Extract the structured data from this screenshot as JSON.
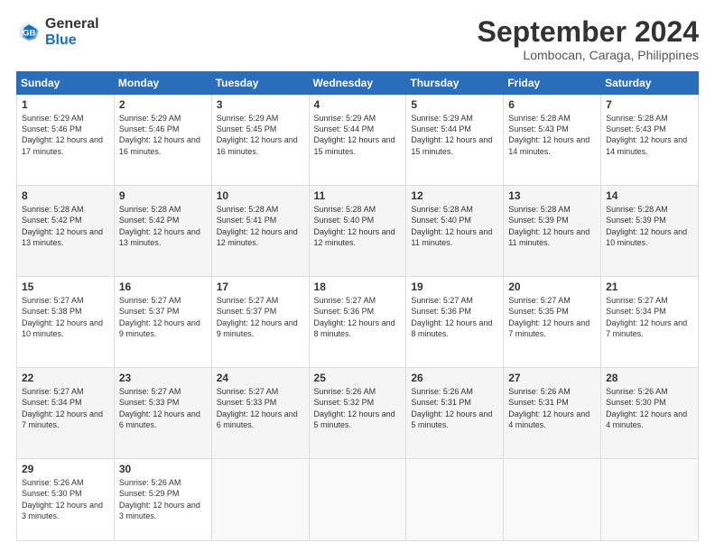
{
  "header": {
    "logo_line1": "General",
    "logo_line2": "Blue",
    "month": "September 2024",
    "location": "Lombocan, Caraga, Philippines"
  },
  "days_of_week": [
    "Sunday",
    "Monday",
    "Tuesday",
    "Wednesday",
    "Thursday",
    "Friday",
    "Saturday"
  ],
  "weeks": [
    [
      {
        "day": "1",
        "sunrise": "5:29 AM",
        "sunset": "5:46 PM",
        "daylight": "12 hours and 17 minutes."
      },
      {
        "day": "2",
        "sunrise": "5:29 AM",
        "sunset": "5:46 PM",
        "daylight": "12 hours and 16 minutes."
      },
      {
        "day": "3",
        "sunrise": "5:29 AM",
        "sunset": "5:45 PM",
        "daylight": "12 hours and 16 minutes."
      },
      {
        "day": "4",
        "sunrise": "5:29 AM",
        "sunset": "5:44 PM",
        "daylight": "12 hours and 15 minutes."
      },
      {
        "day": "5",
        "sunrise": "5:29 AM",
        "sunset": "5:44 PM",
        "daylight": "12 hours and 15 minutes."
      },
      {
        "day": "6",
        "sunrise": "5:28 AM",
        "sunset": "5:43 PM",
        "daylight": "12 hours and 14 minutes."
      },
      {
        "day": "7",
        "sunrise": "5:28 AM",
        "sunset": "5:43 PM",
        "daylight": "12 hours and 14 minutes."
      }
    ],
    [
      {
        "day": "8",
        "sunrise": "5:28 AM",
        "sunset": "5:42 PM",
        "daylight": "12 hours and 13 minutes."
      },
      {
        "day": "9",
        "sunrise": "5:28 AM",
        "sunset": "5:42 PM",
        "daylight": "12 hours and 13 minutes."
      },
      {
        "day": "10",
        "sunrise": "5:28 AM",
        "sunset": "5:41 PM",
        "daylight": "12 hours and 12 minutes."
      },
      {
        "day": "11",
        "sunrise": "5:28 AM",
        "sunset": "5:40 PM",
        "daylight": "12 hours and 12 minutes."
      },
      {
        "day": "12",
        "sunrise": "5:28 AM",
        "sunset": "5:40 PM",
        "daylight": "12 hours and 11 minutes."
      },
      {
        "day": "13",
        "sunrise": "5:28 AM",
        "sunset": "5:39 PM",
        "daylight": "12 hours and 11 minutes."
      },
      {
        "day": "14",
        "sunrise": "5:28 AM",
        "sunset": "5:39 PM",
        "daylight": "12 hours and 10 minutes."
      }
    ],
    [
      {
        "day": "15",
        "sunrise": "5:27 AM",
        "sunset": "5:38 PM",
        "daylight": "12 hours and 10 minutes."
      },
      {
        "day": "16",
        "sunrise": "5:27 AM",
        "sunset": "5:37 PM",
        "daylight": "12 hours and 9 minutes."
      },
      {
        "day": "17",
        "sunrise": "5:27 AM",
        "sunset": "5:37 PM",
        "daylight": "12 hours and 9 minutes."
      },
      {
        "day": "18",
        "sunrise": "5:27 AM",
        "sunset": "5:36 PM",
        "daylight": "12 hours and 8 minutes."
      },
      {
        "day": "19",
        "sunrise": "5:27 AM",
        "sunset": "5:36 PM",
        "daylight": "12 hours and 8 minutes."
      },
      {
        "day": "20",
        "sunrise": "5:27 AM",
        "sunset": "5:35 PM",
        "daylight": "12 hours and 7 minutes."
      },
      {
        "day": "21",
        "sunrise": "5:27 AM",
        "sunset": "5:34 PM",
        "daylight": "12 hours and 7 minutes."
      }
    ],
    [
      {
        "day": "22",
        "sunrise": "5:27 AM",
        "sunset": "5:34 PM",
        "daylight": "12 hours and 7 minutes."
      },
      {
        "day": "23",
        "sunrise": "5:27 AM",
        "sunset": "5:33 PM",
        "daylight": "12 hours and 6 minutes."
      },
      {
        "day": "24",
        "sunrise": "5:27 AM",
        "sunset": "5:33 PM",
        "daylight": "12 hours and 6 minutes."
      },
      {
        "day": "25",
        "sunrise": "5:26 AM",
        "sunset": "5:32 PM",
        "daylight": "12 hours and 5 minutes."
      },
      {
        "day": "26",
        "sunrise": "5:26 AM",
        "sunset": "5:31 PM",
        "daylight": "12 hours and 5 minutes."
      },
      {
        "day": "27",
        "sunrise": "5:26 AM",
        "sunset": "5:31 PM",
        "daylight": "12 hours and 4 minutes."
      },
      {
        "day": "28",
        "sunrise": "5:26 AM",
        "sunset": "5:30 PM",
        "daylight": "12 hours and 4 minutes."
      }
    ],
    [
      {
        "day": "29",
        "sunrise": "5:26 AM",
        "sunset": "5:30 PM",
        "daylight": "12 hours and 3 minutes."
      },
      {
        "day": "30",
        "sunrise": "5:26 AM",
        "sunset": "5:29 PM",
        "daylight": "12 hours and 3 minutes."
      },
      null,
      null,
      null,
      null,
      null
    ]
  ]
}
